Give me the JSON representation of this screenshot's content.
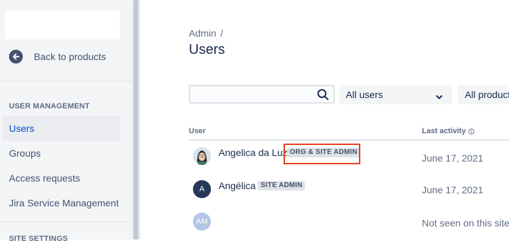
{
  "sidebar": {
    "back_label": "Back to products",
    "user_management_heading": "USER MANAGEMENT",
    "items": [
      {
        "label": "Users",
        "active": true
      },
      {
        "label": "Groups"
      },
      {
        "label": "Access requests"
      },
      {
        "label": "Jira Service Management"
      }
    ],
    "site_settings_heading": "SITE SETTINGS"
  },
  "breadcrumb": {
    "root": "Admin",
    "separator": "/"
  },
  "page": {
    "title": "Users"
  },
  "filters": {
    "search_placeholder": "",
    "user_filter": "All users",
    "product_filter": "All products"
  },
  "table": {
    "headers": {
      "user": "User",
      "last_activity": "Last activity"
    },
    "rows": [
      {
        "name": "Angelica da Luz",
        "badge": "ORG & SITE ADMIN",
        "activity": "June 17, 2021",
        "avatar": "avatar-image"
      },
      {
        "name": "Angélica",
        "badge": "SITE ADMIN",
        "activity": "June 17, 2021",
        "initials": "A"
      },
      {
        "name": "",
        "badge": "",
        "activity": "Not seen on this site",
        "initials": "AM"
      }
    ]
  },
  "colors": {
    "accent": "#0052cc",
    "highlight": "#e53f1c",
    "avatar_dark": "#253858",
    "avatar_light": "#b3c5e6"
  }
}
